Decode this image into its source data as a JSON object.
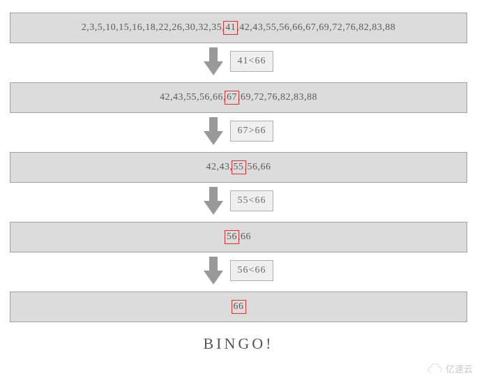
{
  "target": 66,
  "steps": [
    {
      "array": [
        2,
        3,
        5,
        10,
        15,
        16,
        18,
        22,
        26,
        30,
        32,
        35,
        41,
        42,
        43,
        55,
        56,
        66,
        67,
        69,
        72,
        76,
        82,
        83,
        88
      ],
      "mid_index": 12,
      "mid_value": 41,
      "comparison": "41<66"
    },
    {
      "array": [
        42,
        43,
        55,
        56,
        66,
        67,
        69,
        72,
        76,
        82,
        83,
        88
      ],
      "mid_index": 5,
      "mid_value": 67,
      "comparison": "67>66"
    },
    {
      "array": [
        42,
        43,
        55,
        56,
        66
      ],
      "mid_index": 2,
      "mid_value": 55,
      "comparison": "55<66"
    },
    {
      "array": [
        56,
        66
      ],
      "mid_index": 0,
      "mid_value": 56,
      "comparison": "56<66"
    },
    {
      "array": [
        66
      ],
      "mid_index": 0,
      "mid_value": 66,
      "comparison": null
    }
  ],
  "result_label": "BINGO!",
  "watermark": "亿速云"
}
